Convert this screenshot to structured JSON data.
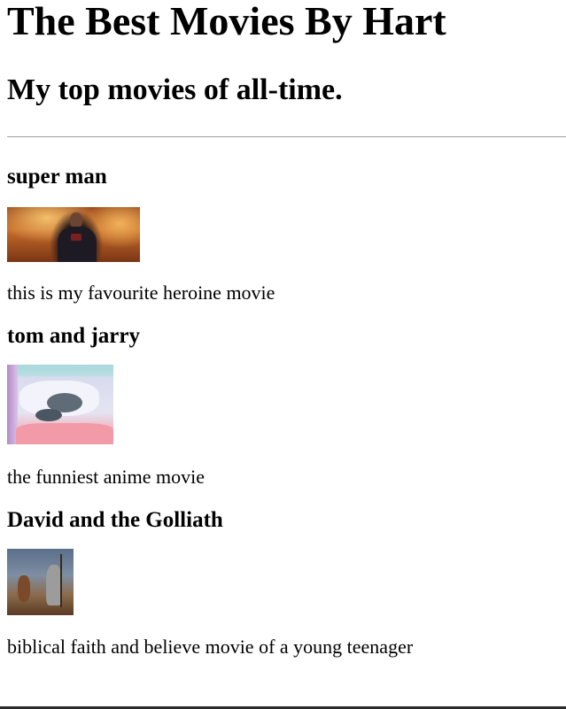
{
  "header": {
    "title": "The Best Movies By Hart",
    "subtitle": "My top movies of all-time."
  },
  "movies": [
    {
      "title": "super man",
      "image_alt": "superman-image",
      "description": "this is my favourite heroine movie"
    },
    {
      "title": "tom and jarry",
      "image_alt": "tom-and-jerry-image",
      "description": "the funniest anime movie"
    },
    {
      "title": "David and the Golliath",
      "image_alt": "david-and-goliath-image",
      "description": "biblical faith and believe movie of a young teenager"
    }
  ]
}
